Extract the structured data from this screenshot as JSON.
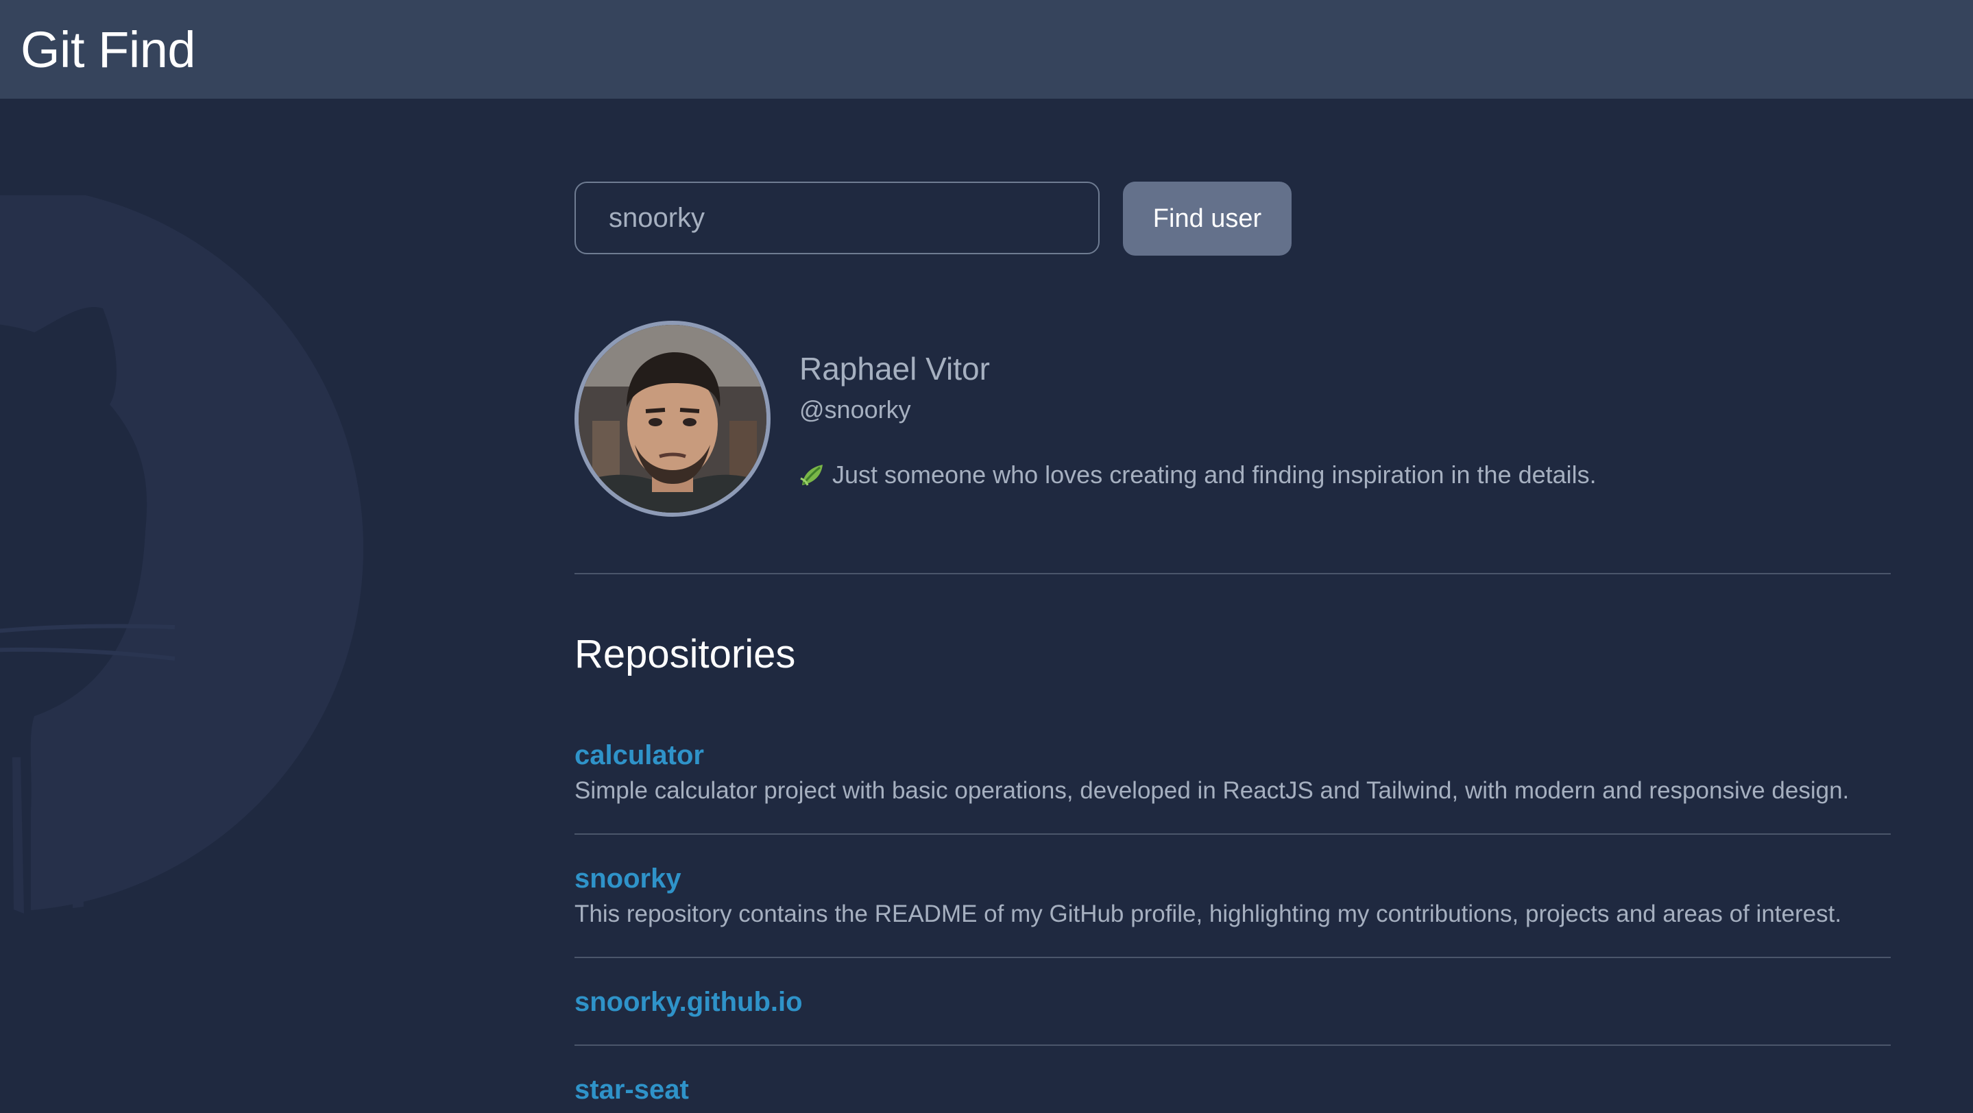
{
  "header": {
    "title": "Git Find"
  },
  "search": {
    "value": "snoorky",
    "placeholder": "",
    "button_label": "Find user"
  },
  "profile": {
    "name": "Raphael Vitor",
    "login": "@snoorky",
    "bio": "Just someone who loves creating and finding inspiration in the details.",
    "bio_icon": "leaf-icon"
  },
  "repositories": {
    "title": "Repositories",
    "items": [
      {
        "name": "calculator",
        "description": "Simple calculator project with basic operations, developed in ReactJS and Tailwind, with modern and responsive design."
      },
      {
        "name": "snoorky",
        "description": "This repository contains the README of my GitHub profile, highlighting my contributions, projects and areas of interest."
      },
      {
        "name": "snoorky.github.io",
        "description": ""
      },
      {
        "name": "star-seat",
        "description": ""
      }
    ]
  },
  "colors": {
    "background": "#1f2940",
    "topbar": "#36445c",
    "button": "#64718b",
    "link": "#2f93c9",
    "muted_text": "#a6b0c0",
    "divider": "#4b566b"
  },
  "icons": {
    "background_logo": "github-octocat-icon",
    "avatar": "user-avatar"
  }
}
